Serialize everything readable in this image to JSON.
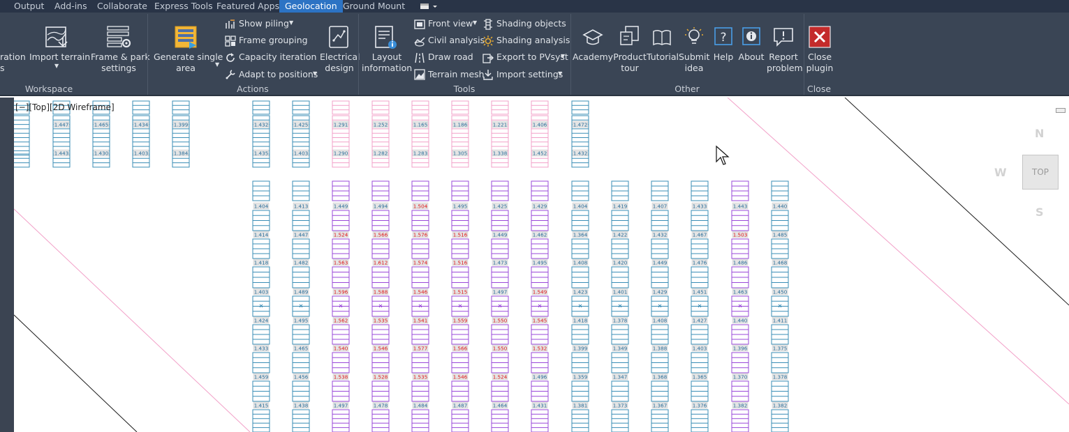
{
  "tabs": [
    {
      "label": "Output",
      "active": false
    },
    {
      "label": "Add-ins",
      "active": false
    },
    {
      "label": "Collaborate",
      "active": false
    },
    {
      "label": "Express Tools",
      "active": false
    },
    {
      "label": "Featured Apps",
      "active": false
    },
    {
      "label": "Geolocation",
      "active": true
    },
    {
      "label": "Ground Mount",
      "active": false
    }
  ],
  "ribbon": {
    "workspace": {
      "cut_label": "ration\ns",
      "import_terrain": "Import terrain",
      "frame_park": "Frame & park\nsettings",
      "title": "Workspace"
    },
    "actions": {
      "generate": "Generate single\narea",
      "show_piling": "Show piling",
      "frame_grouping": "Frame grouping",
      "capacity_iteration": "Capacity iteration",
      "adapt": "Adapt to positions",
      "electrical": "Electrical\ndesign",
      "title": "Actions"
    },
    "tools": {
      "layout_info": "Layout\ninformation",
      "front_view": "Front view",
      "civil": "Civil analysis",
      "draw_road": "Draw road",
      "terrain_mesh": "Terrain mesh",
      "shading_objects": "Shading objects",
      "shading_analysis": "Shading analysis",
      "export_pvsyst": "Export to PVsyst",
      "import_settings": "Import settings",
      "title": "Tools"
    },
    "other": {
      "academy": "Academy",
      "product_tour": "Product\ntour",
      "tutorial": "Tutorial",
      "submit_idea": "Submit\nidea",
      "help": "Help",
      "about": "About",
      "report": "Report\nproblem",
      "title": "Other"
    },
    "close": {
      "close_plugin": "Close\nplugin",
      "title": "Close"
    }
  },
  "viewport": {
    "label": "[−][Top][2D Wireframe]",
    "compass": {
      "n": "N",
      "w": "W",
      "s": "S",
      "top": "TOP"
    }
  },
  "colors": {
    "tabbar_bg": "#293447",
    "active_tab": "#2c73c4",
    "ribbon_bg": "#3a4555",
    "panel_blue": "#3a8db5",
    "panel_pink": "#f2a0c8",
    "panel_purple": "#9a48d8",
    "value_red": "#e01818",
    "value_blue": "#2a6e9a"
  },
  "layout_data": {
    "top_columns": [
      {
        "color": "blue",
        "values": [
          "",
          ""
        ]
      },
      {
        "color": "blue",
        "values": [
          "1.447",
          "1.443"
        ]
      },
      {
        "color": "blue",
        "values": [
          "1.465",
          "1.430"
        ]
      },
      {
        "color": "blue",
        "values": [
          "1.434",
          "1.403"
        ]
      },
      {
        "color": "blue",
        "values": [
          "1.399",
          "1.384"
        ]
      },
      {
        "color": "blue",
        "values": [
          "1.432",
          "1.435"
        ]
      },
      {
        "color": "blue",
        "values": [
          "1.425",
          "1.403"
        ]
      },
      {
        "color": "pink",
        "values": [
          "1.291",
          "1.290"
        ]
      },
      {
        "color": "pink",
        "values": [
          "1.252",
          "1.282"
        ]
      },
      {
        "color": "pink",
        "values": [
          "1.165",
          "1.283"
        ]
      },
      {
        "color": "pink",
        "values": [
          "1.186",
          "1.305"
        ]
      },
      {
        "color": "pink",
        "values": [
          "1.221",
          "1.338"
        ]
      },
      {
        "color": "pink",
        "values": [
          "1.406",
          "1.452"
        ]
      },
      {
        "color": "blue",
        "values": [
          "1.472",
          "1.432"
        ]
      }
    ],
    "bottom_columns": [
      {
        "color": "blue",
        "values": [
          "1.404",
          "1.414",
          "1.418",
          "1.403",
          "1.424",
          "1.433",
          "1.459",
          "1.415"
        ]
      },
      {
        "color": "blue",
        "values": [
          "1.413",
          "1.447",
          "1.482",
          "1.489",
          "1.495",
          "1.465",
          "1.456",
          "1.438"
        ]
      },
      {
        "color": "purple",
        "values": [
          "1.449",
          "1.524",
          "1.563",
          "1.596",
          "1.562",
          "1.540",
          "1.538",
          "1.497"
        ]
      },
      {
        "color": "purple",
        "values": [
          "1.494",
          "1.566",
          "1.612",
          "1.588",
          "1.535",
          "1.546",
          "1.528",
          "1.478"
        ]
      },
      {
        "color": "purple",
        "values": [
          "1.504",
          "1.576",
          "1.574",
          "1.546",
          "1.541",
          "1.577",
          "1.535",
          "1.484"
        ]
      },
      {
        "color": "purple",
        "values": [
          "1.495",
          "1.516",
          "1.516",
          "1.515",
          "1.559",
          "1.566",
          "1.546",
          "1.487"
        ]
      },
      {
        "color": "purple",
        "values": [
          "1.425",
          "1.449",
          "1.473",
          "1.497",
          "1.550",
          "1.550",
          "1.524",
          "1.464"
        ]
      },
      {
        "color": "purple",
        "values": [
          "1.429",
          "1.462",
          "1.495",
          "1.549",
          "1.545",
          "1.532",
          "1.496",
          "1.431"
        ]
      },
      {
        "color": "blue",
        "values": [
          "1.404",
          "1.364",
          "1.408",
          "1.423",
          "1.418",
          "1.399",
          "1.359",
          "1.381"
        ]
      },
      {
        "color": "blue",
        "values": [
          "1.419",
          "1.422",
          "1.420",
          "1.401",
          "1.378",
          "1.349",
          "1.347",
          "1.373"
        ]
      },
      {
        "color": "blue",
        "values": [
          "1.407",
          "1.432",
          "1.449",
          "1.429",
          "1.408",
          "1.388",
          "1.368",
          "1.367"
        ]
      },
      {
        "color": "blue",
        "values": [
          "1.433",
          "1.467",
          "1.476",
          "1.451",
          "1.427",
          "1.403",
          "1.365",
          "1.376"
        ]
      },
      {
        "color": "purple",
        "values": [
          "1.443",
          "1.503",
          "1.486",
          "1.463",
          "1.440",
          "1.396",
          "1.370",
          "1.382"
        ]
      },
      {
        "color": "blue",
        "values": [
          "1.440",
          "1.485",
          "1.468",
          "1.450",
          "1.411",
          "1.375",
          "1.378",
          "1.382"
        ]
      }
    ],
    "red_threshold": 1.5
  }
}
